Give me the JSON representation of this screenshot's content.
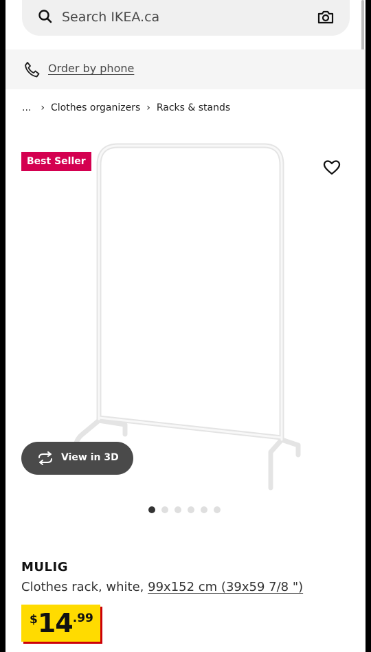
{
  "search": {
    "placeholder": "Search IKEA.ca"
  },
  "phone": {
    "label": "Order by phone"
  },
  "breadcrumb": {
    "ellipsis": "...",
    "items": [
      "Clothes organizers",
      "Racks & stands"
    ]
  },
  "product": {
    "badge": "Best Seller",
    "name": "MULIG",
    "description": "Clothes rack, white,",
    "dimensions": "99x152 cm (39x59 7/8 \")",
    "price": {
      "currency": "$",
      "integer": "14",
      "decimal": ".99"
    },
    "view3d_label": "View in 3D",
    "carousel": {
      "total": 6,
      "active": 1
    }
  },
  "colors": {
    "badge": "#d40050",
    "price_bg": "#ffdb00",
    "price_shadow": "#cc0008"
  },
  "icons": [
    "search-icon",
    "camera-icon",
    "phone-icon",
    "heart-icon",
    "rotate-3d-icon"
  ]
}
